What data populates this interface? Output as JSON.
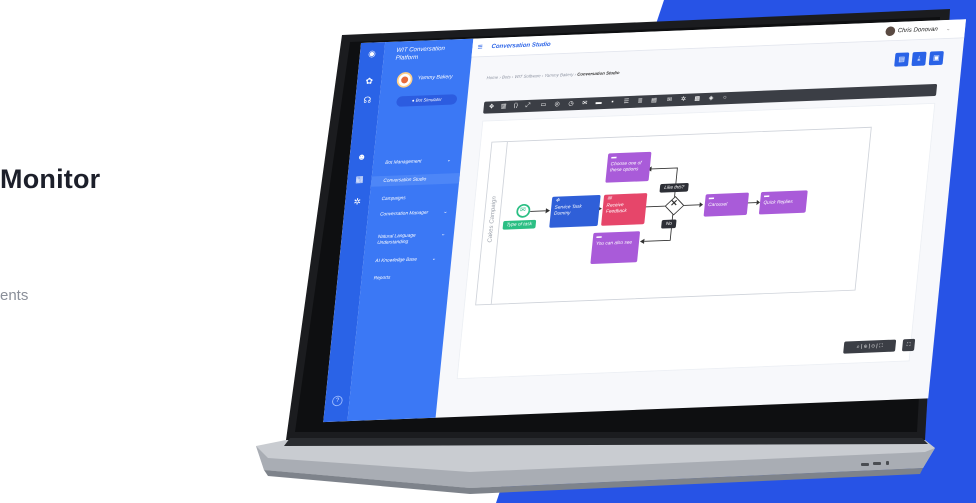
{
  "marketing": {
    "headline": "Monitor",
    "subcopy": "ents"
  },
  "colors": {
    "brand_blue": "#2a63e7",
    "menu_blue": "#3b78f5",
    "bg_blue": "#2753e6",
    "node_purple": "#9b59d6",
    "node_pink": "#e6466a",
    "node_green": "#2bbf84",
    "toolbar_dark": "#3b3e45"
  },
  "app": {
    "brand": "WIT Conversation Platform",
    "bot_name": "Yammy Bakery",
    "bot_simulator": "Bot Simulator",
    "menu": [
      {
        "label": "Bot Management",
        "chev": "⌄"
      },
      {
        "label": "Conversation Studio",
        "chev": ""
      },
      {
        "label": "Campaigns",
        "chev": ""
      },
      {
        "label": "Conversation Manager",
        "chev": "⌄"
      },
      {
        "label": "Natural Language Understanding",
        "chev": "⌄"
      },
      {
        "label": "AI Knowledge Base",
        "chev": "⌄"
      },
      {
        "label": "Reports",
        "chev": ""
      }
    ],
    "page_title": "Conversation Studio",
    "user": "Chris Donovan",
    "user_chev": "⌄",
    "breadcrumb": {
      "path": "Home › Bots › WIT Software › Yammy Bakery › ",
      "current": "Conversation Studio"
    },
    "actions": [
      "new-file-icon",
      "download-icon",
      "save-icon"
    ],
    "toolbar_icons": [
      "move-icon",
      "grid-icon",
      "code-icon",
      "link-icon",
      "frame-icon",
      "image-icon",
      "clock-icon",
      "mail-icon",
      "chat-icon",
      "card-icon",
      "list-icon",
      "menu-icon",
      "doc-icon",
      "mail-outline-icon",
      "gear-icon",
      "media-icon",
      "diamond-icon",
      "circle-icon"
    ]
  },
  "diagram": {
    "pool_label": "Cakes Campaign",
    "start_label": "Type of task",
    "service_task": "Service Task Dummy",
    "receive_feedback": "Receive Feedback",
    "choose_options": "Choose one of these options",
    "like_this": "Like this?",
    "no_label": "No",
    "you_can_also": "You can also see",
    "carousel": "Carousel",
    "quick_replies": "Quick Replies"
  },
  "zoom": {
    "controls": "⌕ | ⊕ | ⊖ | ⛶",
    "fit": "⛶"
  }
}
